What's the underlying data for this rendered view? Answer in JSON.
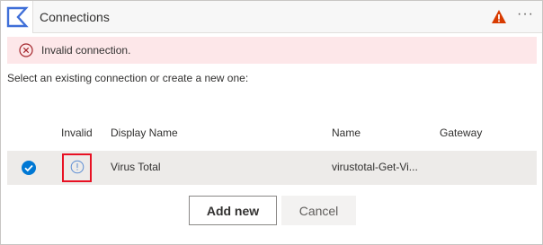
{
  "header": {
    "title": "Connections",
    "more_label": "···"
  },
  "error": {
    "message": "Invalid connection."
  },
  "instruction": "Select an existing connection or create a new one:",
  "table": {
    "columns": [
      "Invalid",
      "Display Name",
      "Name",
      "Gateway"
    ],
    "rows": [
      {
        "selected": true,
        "invalid": true,
        "display_name": "Virus Total",
        "name": "virustotal-Get-Vi...",
        "gateway": ""
      }
    ]
  },
  "buttons": {
    "add_label": "Add new",
    "cancel_label": "Cancel"
  },
  "colors": {
    "accent": "#0078d4",
    "error_bg": "#fde7e9",
    "error_icon": "#a4262c",
    "warning": "#d83b01",
    "highlight_border": "#e81123"
  },
  "icons": {
    "logo": "sigma-logo-icon",
    "warning": "warning-icon",
    "error": "error-circle-icon",
    "selected": "checkmark-circle-icon",
    "invalid": "info-circle-icon"
  }
}
